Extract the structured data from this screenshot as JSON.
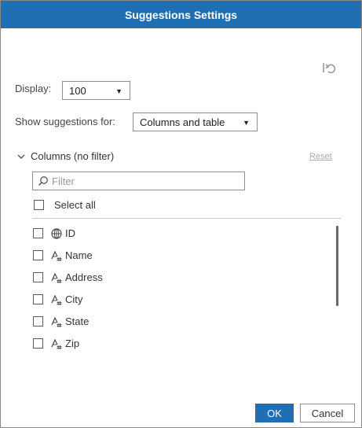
{
  "dialog": {
    "title": "Suggestions Settings"
  },
  "toolbar": {
    "reset_icon": "undo-reset-icon"
  },
  "display": {
    "label": "Display:",
    "value": "100"
  },
  "show_for": {
    "label": "Show suggestions for:",
    "value": "Columns and table"
  },
  "columns_section": {
    "title": "Columns (no filter)",
    "reset_label": "Reset",
    "filter_placeholder": "Filter",
    "select_all_label": "Select all",
    "items": [
      {
        "label": "ID",
        "icon": "globe-id-icon"
      },
      {
        "label": "Name",
        "icon": "text-field-icon"
      },
      {
        "label": "Address",
        "icon": "text-field-icon"
      },
      {
        "label": "City",
        "icon": "text-field-icon"
      },
      {
        "label": "State",
        "icon": "text-field-icon"
      },
      {
        "label": "Zip",
        "icon": "text-field-icon"
      }
    ]
  },
  "buttons": {
    "ok": "OK",
    "cancel": "Cancel"
  },
  "colors": {
    "accent": "#1f6fb2"
  }
}
